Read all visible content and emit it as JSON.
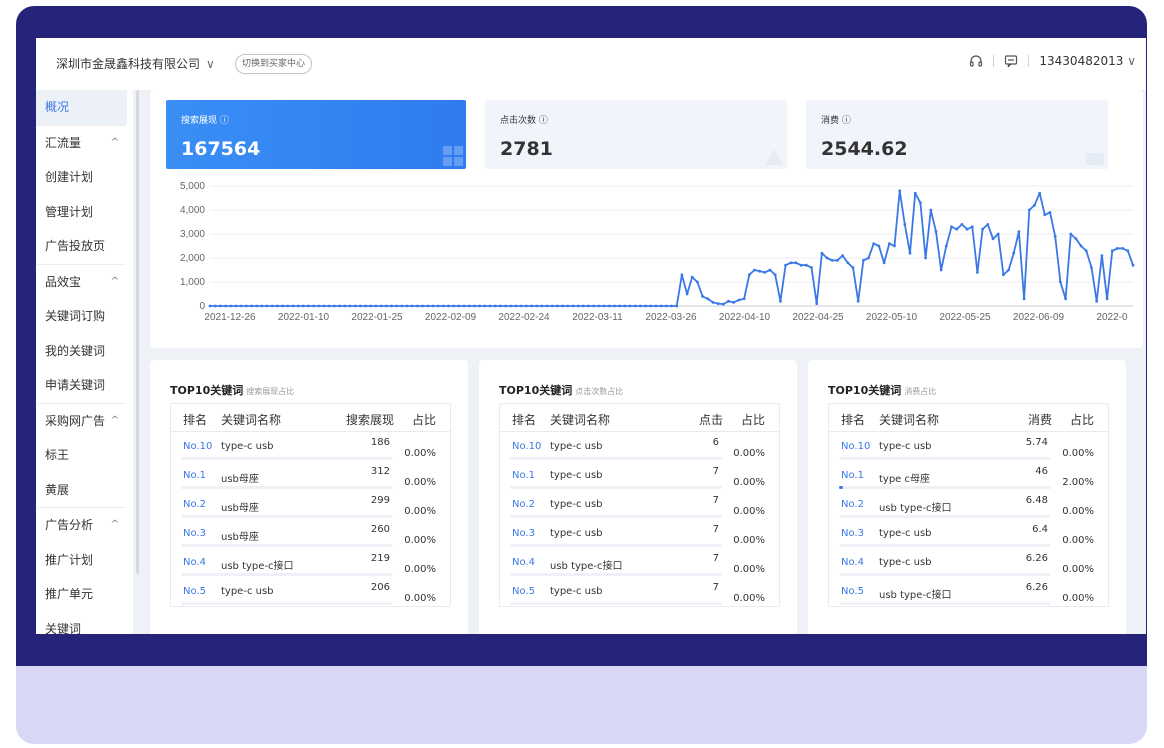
{
  "header": {
    "company": "深圳市金晟鑫科技有限公司",
    "switch_label": "切换到买家中心",
    "phone": "13430482013"
  },
  "sidebar": {
    "items": [
      {
        "label": "概况",
        "active": true
      },
      {
        "label": "汇流量",
        "group": true
      },
      {
        "label": "创建计划"
      },
      {
        "label": "管理计划"
      },
      {
        "label": "广告投放页"
      },
      {
        "label": "品效宝",
        "group": true
      },
      {
        "label": "关键词订购"
      },
      {
        "label": "我的关键词"
      },
      {
        "label": "申请关键词"
      },
      {
        "label": "采购网广告",
        "group": true
      },
      {
        "label": "标王"
      },
      {
        "label": "黄展"
      },
      {
        "label": "广告分析",
        "group": true
      },
      {
        "label": "推广计划"
      },
      {
        "label": "推广单元"
      },
      {
        "label": "关键词"
      }
    ]
  },
  "stats": [
    {
      "label": "搜索展现",
      "value": "167564"
    },
    {
      "label": "点击次数",
      "value": "2781"
    },
    {
      "label": "消费",
      "value": "2544.62"
    }
  ],
  "chart_data": {
    "type": "line",
    "x_ticks": [
      "2021-12-26",
      "2022-01-10",
      "2022-01-25",
      "2022-02-09",
      "2022-02-24",
      "2022-03-11",
      "2022-03-26",
      "2022-04-10",
      "2022-04-25",
      "2022-05-10",
      "2022-05-25",
      "2022-06-09",
      "2022-0"
    ],
    "y_ticks": [
      "0",
      "1,000",
      "2,000",
      "3,000",
      "4,000",
      "5,000"
    ],
    "ylim": [
      0,
      5000
    ],
    "color": "#3a78e6",
    "series": [
      {
        "values": [
          0,
          0,
          0,
          0,
          0,
          0,
          0,
          0,
          0,
          0,
          0,
          0,
          0,
          0,
          0,
          0,
          0,
          0,
          0,
          0,
          0,
          0,
          0,
          0,
          0,
          0,
          0,
          0,
          0,
          0,
          0,
          0,
          0,
          0,
          0,
          0,
          0,
          0,
          0,
          0,
          0,
          0,
          0,
          0,
          0,
          0,
          0,
          0,
          0,
          0,
          0,
          0,
          0,
          0,
          0,
          0,
          0,
          0,
          0,
          0,
          0,
          0,
          0,
          0,
          0,
          0,
          0,
          0,
          0,
          0,
          0,
          0,
          0,
          0,
          0,
          0,
          0,
          0,
          0,
          0,
          0,
          0,
          0,
          0,
          0,
          0,
          0,
          0,
          0,
          0,
          0,
          1300,
          500,
          1200,
          1000,
          400,
          300,
          150,
          100,
          80,
          200,
          150,
          250,
          300,
          1300,
          1500,
          1450,
          1400,
          1500,
          1300,
          200,
          1700,
          1800,
          1800,
          1700,
          1700,
          1600,
          100,
          2200,
          2000,
          1900,
          1900,
          2100,
          1800,
          1600,
          200,
          1900,
          2000,
          2600,
          2500,
          1800,
          2600,
          2500,
          4800,
          3400,
          2200,
          4700,
          4300,
          2000,
          4000,
          3100,
          1500,
          2500,
          3300,
          3200,
          3400,
          3200,
          3300,
          1400,
          3200,
          3400,
          2800,
          3000,
          1300,
          1500,
          2200,
          3100,
          300,
          4000,
          4200,
          4700,
          3800,
          3900,
          2900,
          1000,
          300,
          3000,
          2800,
          2500,
          2300,
          1600,
          200,
          2100,
          300,
          2300,
          2400,
          2400,
          2300,
          1700
        ]
      }
    ]
  },
  "panels": [
    {
      "title": "TOP10关键词",
      "subtitle": "搜索展现占比",
      "headers": [
        "排名",
        "关键词名称",
        "搜索展现",
        "占比"
      ],
      "rows": [
        {
          "rank": "No.10",
          "keyword": "type-c usb",
          "value": "186",
          "pct": "0.00%",
          "share": 0
        },
        {
          "rank": "No.1",
          "keyword": "usb母座",
          "value": "312",
          "pct": "0.00%",
          "share": 0
        },
        {
          "rank": "No.2",
          "keyword": "usb母座",
          "value": "299",
          "pct": "0.00%",
          "share": 0
        },
        {
          "rank": "No.3",
          "keyword": "usb母座",
          "value": "260",
          "pct": "0.00%",
          "share": 0
        },
        {
          "rank": "No.4",
          "keyword": "usb type-c接口",
          "value": "219",
          "pct": "0.00%",
          "share": 0
        },
        {
          "rank": "No.5",
          "keyword": "type-c usb",
          "value": "206",
          "pct": "0.00%",
          "share": 0
        }
      ]
    },
    {
      "title": "TOP10关键词",
      "subtitle": "点击次数占比",
      "headers": [
        "排名",
        "关键词名称",
        "点击",
        "占比"
      ],
      "rows": [
        {
          "rank": "No.10",
          "keyword": "type-c usb",
          "value": "6",
          "pct": "0.00%",
          "share": 0
        },
        {
          "rank": "No.1",
          "keyword": "type-c usb",
          "value": "7",
          "pct": "0.00%",
          "share": 0
        },
        {
          "rank": "No.2",
          "keyword": "type-c usb",
          "value": "7",
          "pct": "0.00%",
          "share": 0
        },
        {
          "rank": "No.3",
          "keyword": "type-c usb",
          "value": "7",
          "pct": "0.00%",
          "share": 0
        },
        {
          "rank": "No.4",
          "keyword": "usb type-c接口",
          "value": "7",
          "pct": "0.00%",
          "share": 0
        },
        {
          "rank": "No.5",
          "keyword": "type-c usb",
          "value": "7",
          "pct": "0.00%",
          "share": 0
        }
      ]
    },
    {
      "title": "TOP10关键词",
      "subtitle": "消费占比",
      "headers": [
        "排名",
        "关键词名称",
        "消费",
        "占比"
      ],
      "rows": [
        {
          "rank": "No.10",
          "keyword": "type-c usb",
          "value": "5.74",
          "pct": "0.00%",
          "share": 0
        },
        {
          "rank": "No.1",
          "keyword": "type c母座",
          "value": "46",
          "pct": "2.00%",
          "share": 0.02
        },
        {
          "rank": "No.2",
          "keyword": "usb type-c接口",
          "value": "6.48",
          "pct": "0.00%",
          "share": 0
        },
        {
          "rank": "No.3",
          "keyword": "type-c usb",
          "value": "6.4",
          "pct": "0.00%",
          "share": 0
        },
        {
          "rank": "No.4",
          "keyword": "type-c usb",
          "value": "6.26",
          "pct": "0.00%",
          "share": 0
        },
        {
          "rank": "No.5",
          "keyword": "usb type-c接口",
          "value": "6.26",
          "pct": "0.00%",
          "share": 0
        }
      ]
    }
  ]
}
